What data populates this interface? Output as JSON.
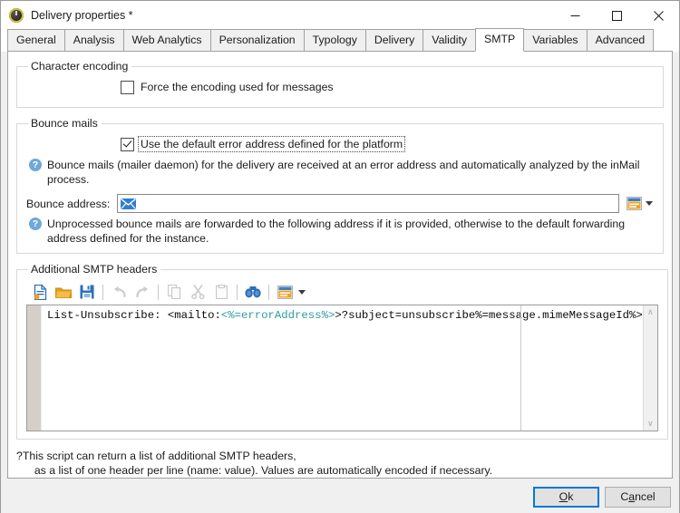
{
  "window": {
    "title": "Delivery properties *",
    "app_icon": "delivery-icon",
    "minimize_label": "Minimize",
    "maximize_label": "Maximize",
    "close_label": "Close"
  },
  "tabs": [
    {
      "label": "General",
      "active": false
    },
    {
      "label": "Analysis",
      "active": false
    },
    {
      "label": "Web Analytics",
      "active": false
    },
    {
      "label": "Personalization",
      "active": false
    },
    {
      "label": "Typology",
      "active": false
    },
    {
      "label": "Delivery",
      "active": false
    },
    {
      "label": "Validity",
      "active": false
    },
    {
      "label": "SMTP",
      "active": true
    },
    {
      "label": "Variables",
      "active": false
    },
    {
      "label": "Advanced",
      "active": false
    }
  ],
  "character_encoding": {
    "legend": "Character encoding",
    "force_encoding": {
      "label": "Force the encoding used for messages",
      "checked": false
    }
  },
  "bounce_mails": {
    "legend": "Bounce mails",
    "default_error_address": {
      "label": "Use the default error address defined for the platform",
      "checked": true,
      "focused": true
    },
    "hint": "Bounce mails (mailer daemon) for the delivery are received at an error address and automatically analyzed by the inMail process.",
    "bounce_address": {
      "label": "Bounce address:",
      "value": "",
      "icon": "envelope-icon",
      "personalization_button": "personalization-field-icon",
      "dropdown": "chevron-down-icon"
    },
    "hint2_line1": "Unprocessed bounce mails are forwarded to the following address if it is provided, otherwise to the default forwarding address defined",
    "hint2_line2": "for the instance."
  },
  "additional_headers": {
    "legend": "Additional SMTP headers",
    "toolbar": [
      {
        "name": "new-file-icon",
        "label": "New",
        "enabled": true
      },
      {
        "name": "open-folder-icon",
        "label": "Open",
        "enabled": true
      },
      {
        "name": "save-icon",
        "label": "Save",
        "enabled": true
      },
      {
        "name": "undo-icon",
        "label": "Undo",
        "enabled": false
      },
      {
        "name": "redo-icon",
        "label": "Redo",
        "enabled": false
      },
      {
        "name": "copy-icon",
        "label": "Copy",
        "enabled": false
      },
      {
        "name": "cut-icon",
        "label": "Cut",
        "enabled": false
      },
      {
        "name": "paste-icon",
        "label": "Paste",
        "enabled": false
      },
      {
        "name": "binoculars-icon",
        "label": "Search",
        "enabled": true
      },
      {
        "name": "personalization-field-icon",
        "label": "Insert personalization field",
        "enabled": true
      }
    ],
    "script": {
      "prefix": "List-Unsubscribe: <mailto:",
      "variable": "<%=errorAddress%>",
      "suffix": ">?subject=unsubscribe%=message.mimeMessageId%>"
    },
    "scrollbar_up": "∧",
    "scrollbar_down": "∨"
  },
  "footer_hint": {
    "line1": "This script can return a list of additional SMTP headers,",
    "line2": "as a list of one header per line (name: value). Values are automatically encoded if necessary."
  },
  "buttons": {
    "ok_pre": "O",
    "ok_accel": "k",
    "ok_full": "Ok",
    "cancel_pre": "C",
    "cancel_accel": "a",
    "cancel_post": "ncel",
    "cancel_full": "Cancel"
  },
  "colors": {
    "accent": "#0078d7",
    "hint_badge": "#6ea8d8",
    "code_variable": "#2a9d9d",
    "icon_orange": "#f0a30a",
    "icon_blue": "#2a6fbb"
  }
}
